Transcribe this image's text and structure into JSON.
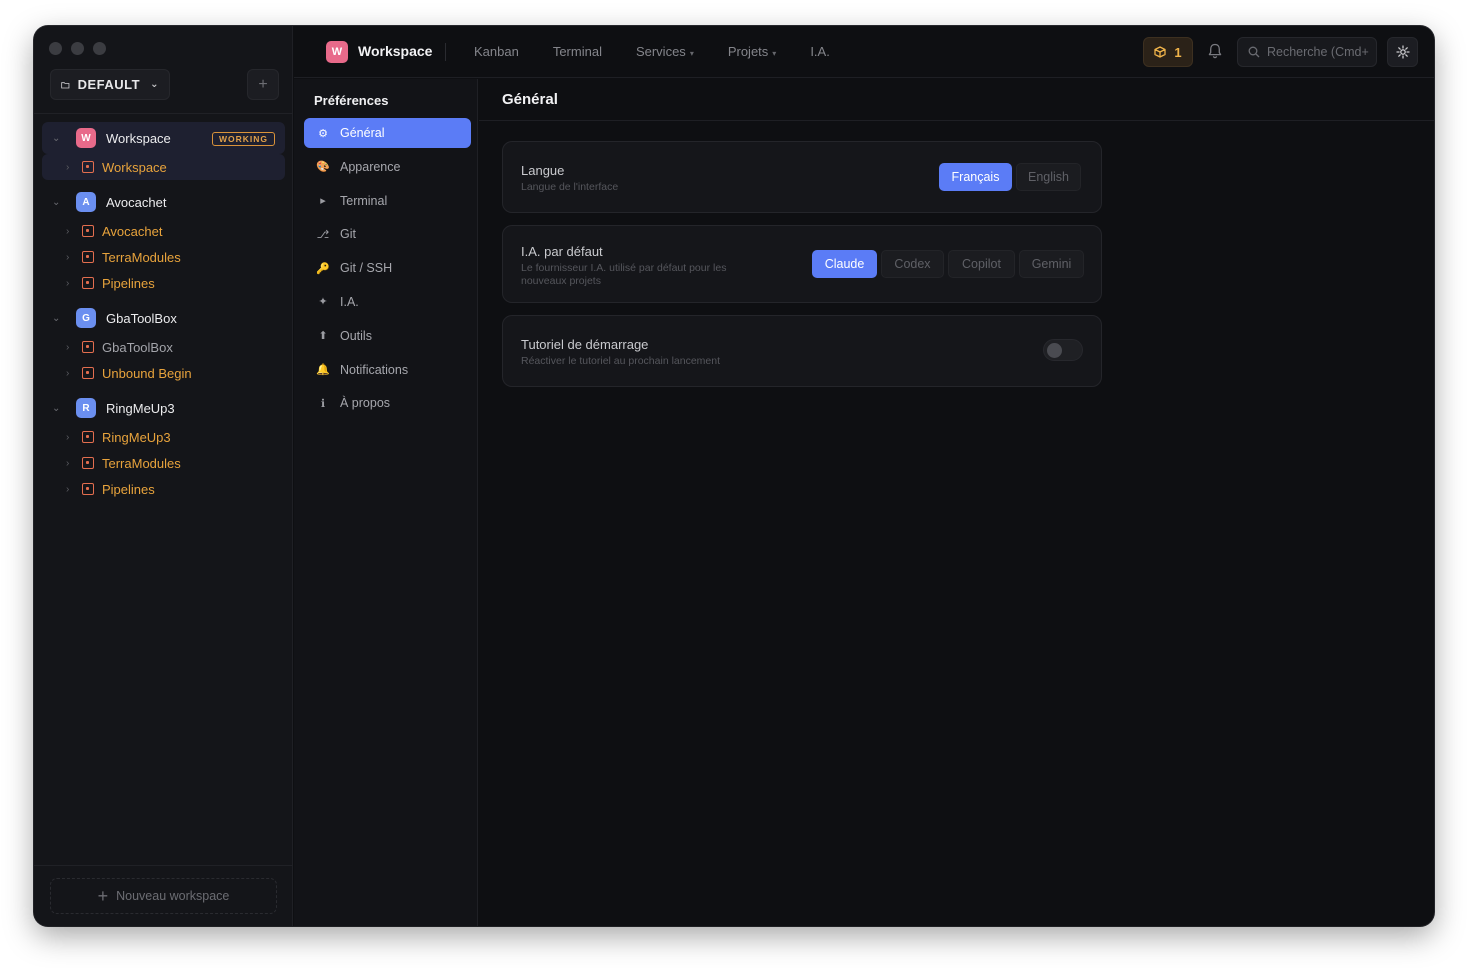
{
  "sidebar": {
    "workspace_selector": "DEFAULT",
    "add_label": "+",
    "groups": [
      {
        "initial": "W",
        "name": "Workspace",
        "color": "#e86a8a",
        "badge": "WORKING",
        "children": [
          {
            "name": "Workspace",
            "active": true
          }
        ]
      },
      {
        "initial": "A",
        "name": "Avocachet",
        "color": "#6b8ff0",
        "children": [
          {
            "name": "Avocachet"
          },
          {
            "name": "TerraModules"
          },
          {
            "name": "Pipelines"
          }
        ]
      },
      {
        "initial": "G",
        "name": "GbaToolBox",
        "color": "#6b8ff0",
        "children": [
          {
            "name": "GbaToolBox",
            "muted": true
          },
          {
            "name": "Unbound Begin"
          }
        ]
      },
      {
        "initial": "R",
        "name": "RingMeUp3",
        "color": "#6b8ff0",
        "children": [
          {
            "name": "RingMeUp3"
          },
          {
            "name": "TerraModules"
          },
          {
            "name": "Pipelines"
          }
        ]
      }
    ],
    "new_workspace": "Nouveau workspace"
  },
  "topbar": {
    "logo_initial": "W",
    "title": "Workspace",
    "nav": [
      "Kanban",
      "Terminal",
      "Services",
      "Projets",
      "I.A."
    ],
    "count": "1",
    "search_placeholder": "Recherche (Cmd+"
  },
  "prefs": {
    "title": "Préférences",
    "items": [
      {
        "icon": "⚙",
        "label": "Général"
      },
      {
        "icon": "🎨",
        "label": "Apparence"
      },
      {
        "icon": "▸",
        "label": "Terminal"
      },
      {
        "icon": "⎇",
        "label": "Git"
      },
      {
        "icon": "🔑",
        "label": "Git / SSH"
      },
      {
        "icon": "✦",
        "label": "I.A."
      },
      {
        "icon": "⬆",
        "label": "Outils"
      },
      {
        "icon": "🔔",
        "label": "Notifications"
      },
      {
        "icon": "ℹ",
        "label": "À propos"
      }
    ]
  },
  "main": {
    "title": "Général",
    "language": {
      "title": "Langue",
      "subtitle": "Langue de l'interface",
      "options": [
        "Français",
        "English"
      ],
      "selected": "Français"
    },
    "ai": {
      "title": "I.A. par défaut",
      "subtitle_line1": "Le fournisseur I.A. utilisé par défaut pour les",
      "subtitle_line2": "nouveaux projets",
      "options": [
        "Claude",
        "Codex",
        "Copilot",
        "Gemini"
      ],
      "selected": "Claude"
    },
    "tutorial": {
      "title": "Tutoriel de démarrage",
      "subtitle": "Réactiver le tutoriel au prochain lancement",
      "enabled": false
    }
  },
  "colors": {
    "accent": "#5b7cf6",
    "project": "#e8a33c",
    "badge": "#d9933a"
  }
}
